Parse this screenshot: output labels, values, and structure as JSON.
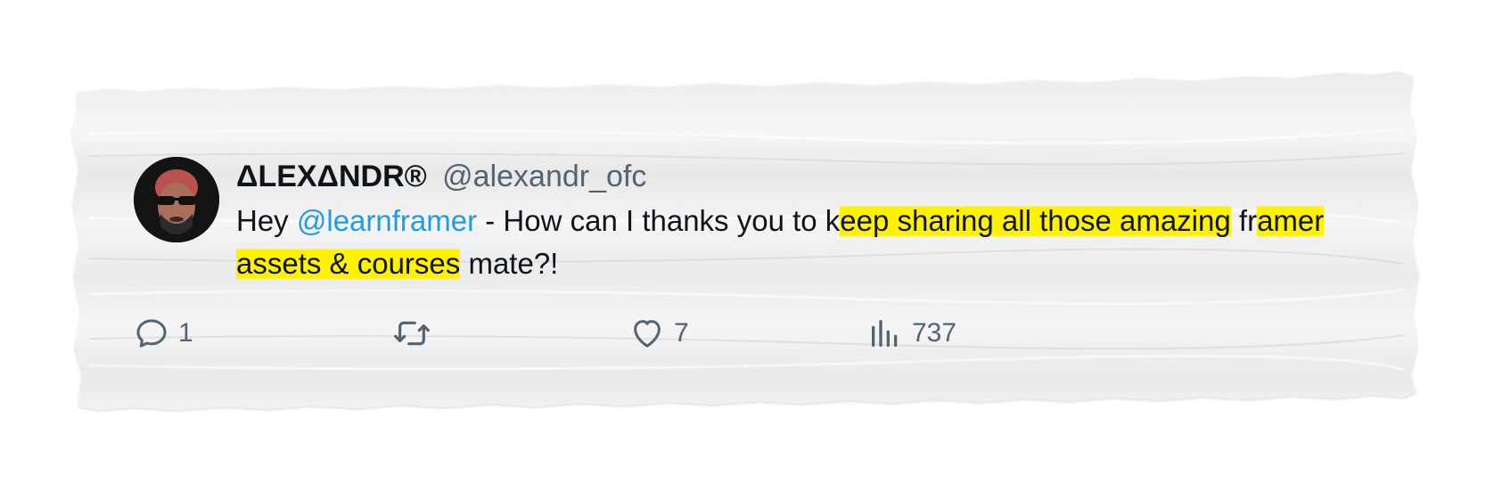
{
  "tweet": {
    "display_name": "ΔLEXΔNDR®",
    "handle": "@alexandr_ofc",
    "text_parts": {
      "p1": "Hey ",
      "mention": "@learnframer",
      "p2": " - How can I thanks you to k",
      "highlight1": "eep sharing all those amazing",
      "p3": " fr",
      "highlight2": "amer assets & courses",
      "p4": " mate?!"
    },
    "highlight_color": "#fff200",
    "mention_color": "#1d9bf0"
  },
  "actions": {
    "reply": {
      "icon": "reply-bubble-icon",
      "count": "1"
    },
    "retweet": {
      "icon": "retweet-icon",
      "count": ""
    },
    "like": {
      "icon": "heart-icon",
      "count": "7"
    },
    "views": {
      "icon": "views-bar-chart-icon",
      "count": "737"
    }
  },
  "colors": {
    "paper": "#f1f1f1",
    "text": "#0f1419",
    "muted": "#536471"
  }
}
